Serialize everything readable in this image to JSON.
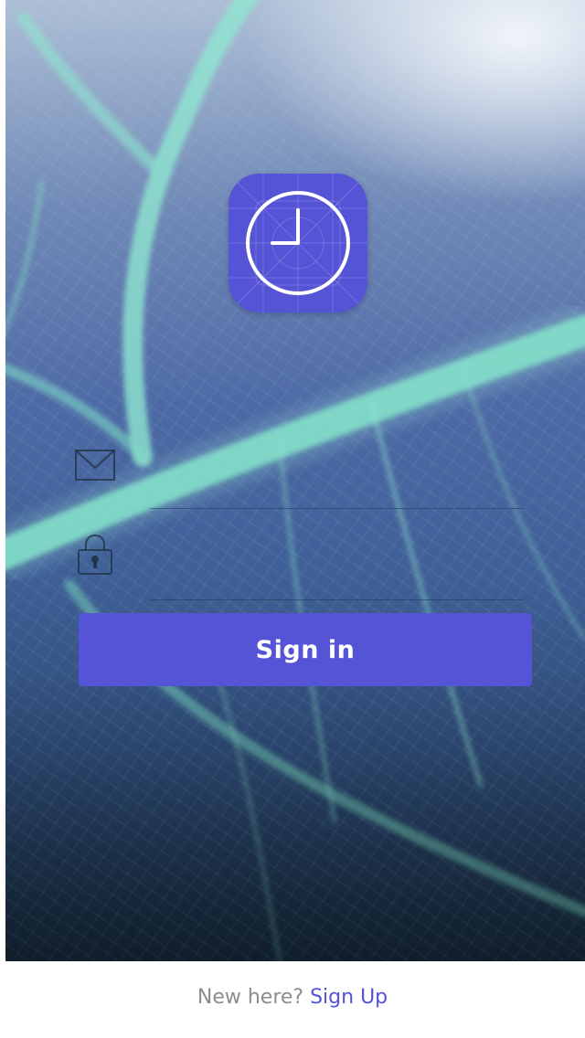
{
  "app_icon": {
    "name": "clock-icon"
  },
  "login": {
    "email_icon": "envelope-icon",
    "password_icon": "padlock-icon",
    "email_value": "",
    "email_placeholder": "",
    "password_value": "",
    "password_placeholder": "",
    "signin_label": "Sign in"
  },
  "footer": {
    "prompt": "New here?",
    "signup_label": "Sign Up"
  },
  "colors": {
    "accent": "#5553d6",
    "footer_text": "#8d8d8d",
    "background": "#ffffff"
  }
}
